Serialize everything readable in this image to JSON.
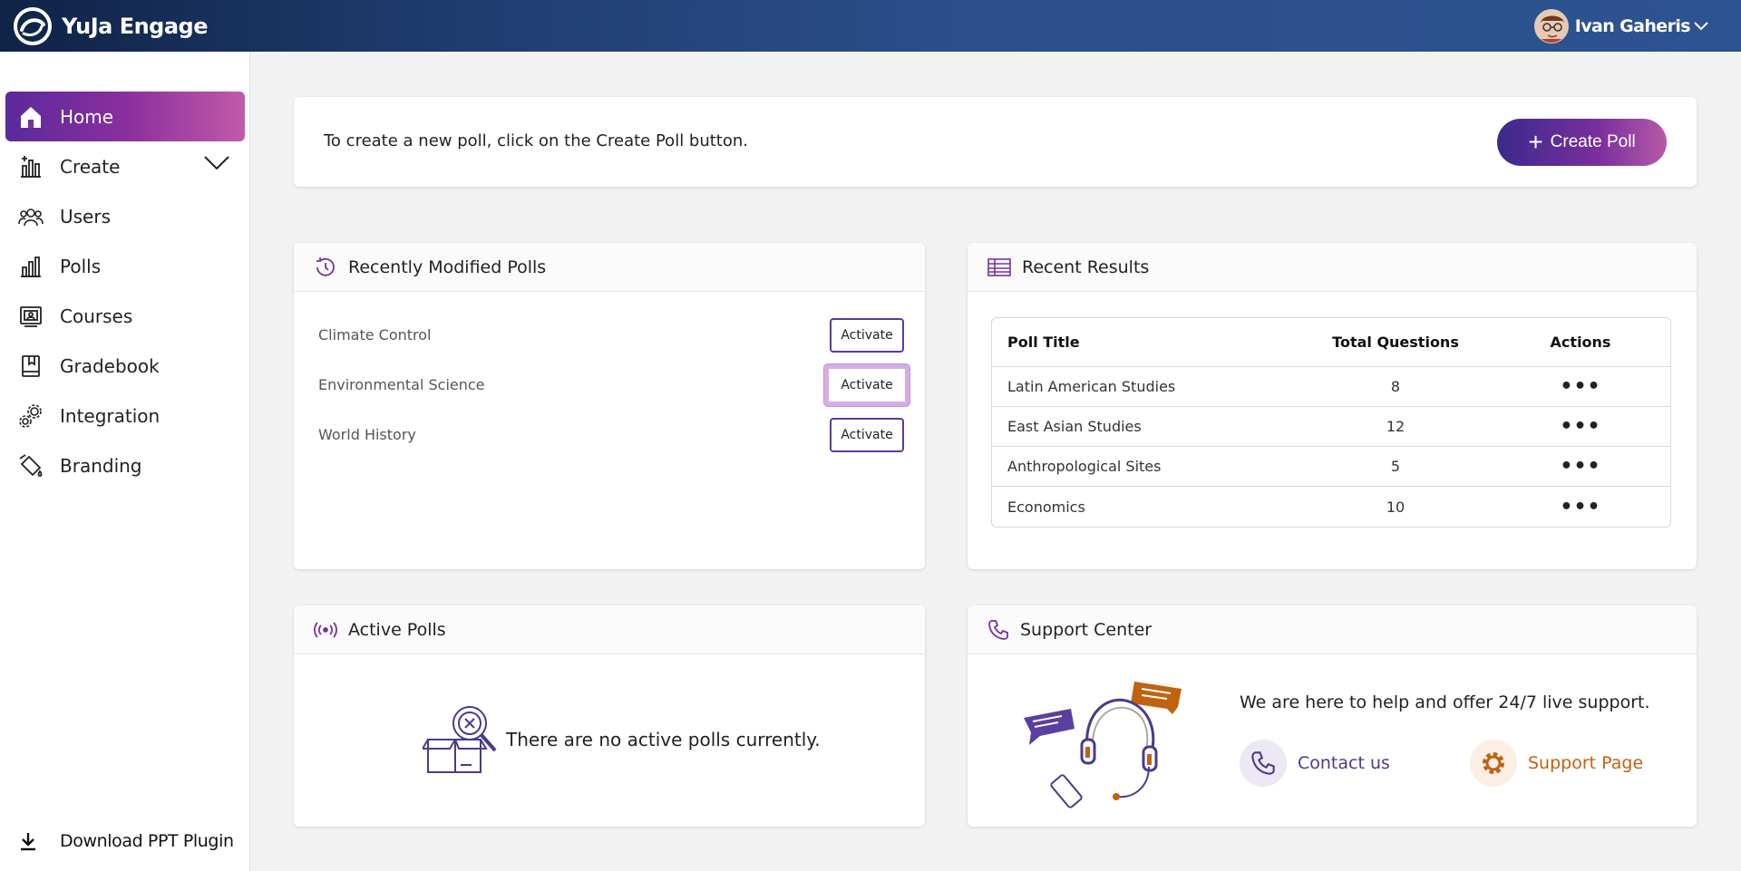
{
  "app": {
    "name": "YuJa Engage"
  },
  "user": {
    "name": "Ivan Gaheris"
  },
  "sidebar": {
    "items": [
      {
        "label": "Home",
        "icon": "home-icon",
        "active": true
      },
      {
        "label": "Create",
        "icon": "create-chart-icon"
      },
      {
        "label": "Users",
        "icon": "users-icon"
      },
      {
        "label": "Polls",
        "icon": "polls-icon"
      },
      {
        "label": "Courses",
        "icon": "courses-icon"
      },
      {
        "label": "Gradebook",
        "icon": "gradebook-icon"
      },
      {
        "label": "Integration",
        "icon": "integration-icon"
      },
      {
        "label": "Branding",
        "icon": "branding-icon"
      }
    ],
    "download_label": "Download PPT Plugin"
  },
  "create_poll": {
    "instruction": "To create a new poll, click on the Create Poll button.",
    "button_label": "Create Poll"
  },
  "recently_modified": {
    "title": "Recently Modified Polls",
    "polls": [
      {
        "name": "Climate Control",
        "action": "Activate"
      },
      {
        "name": "Environmental Science",
        "action": "Activate"
      },
      {
        "name": "World History",
        "action": "Activate"
      }
    ]
  },
  "recent_results": {
    "title": "Recent Results",
    "columns": [
      "Poll Title",
      "Total Questions",
      "Actions"
    ],
    "rows": [
      {
        "title": "Latin American Studies",
        "questions": "8",
        "actions": "•••"
      },
      {
        "title": "East Asian Studies",
        "questions": "12",
        "actions": "•••"
      },
      {
        "title": "Anthropological Sites",
        "questions": "5",
        "actions": "•••"
      },
      {
        "title": "Economics",
        "questions": "10",
        "actions": "•••"
      }
    ]
  },
  "active_polls": {
    "title": "Active Polls",
    "empty_message": "There are no active polls currently."
  },
  "support": {
    "title": "Support Center",
    "message": "We are here to help and offer 24/7 live support.",
    "contact_label": "Contact us",
    "support_page_label": "Support Page"
  },
  "colors": {
    "accent_purple": "#5a2a9c",
    "accent_pink": "#c15aa8",
    "support_orange": "#c0620f",
    "contact_purple": "#4b3a8c"
  }
}
